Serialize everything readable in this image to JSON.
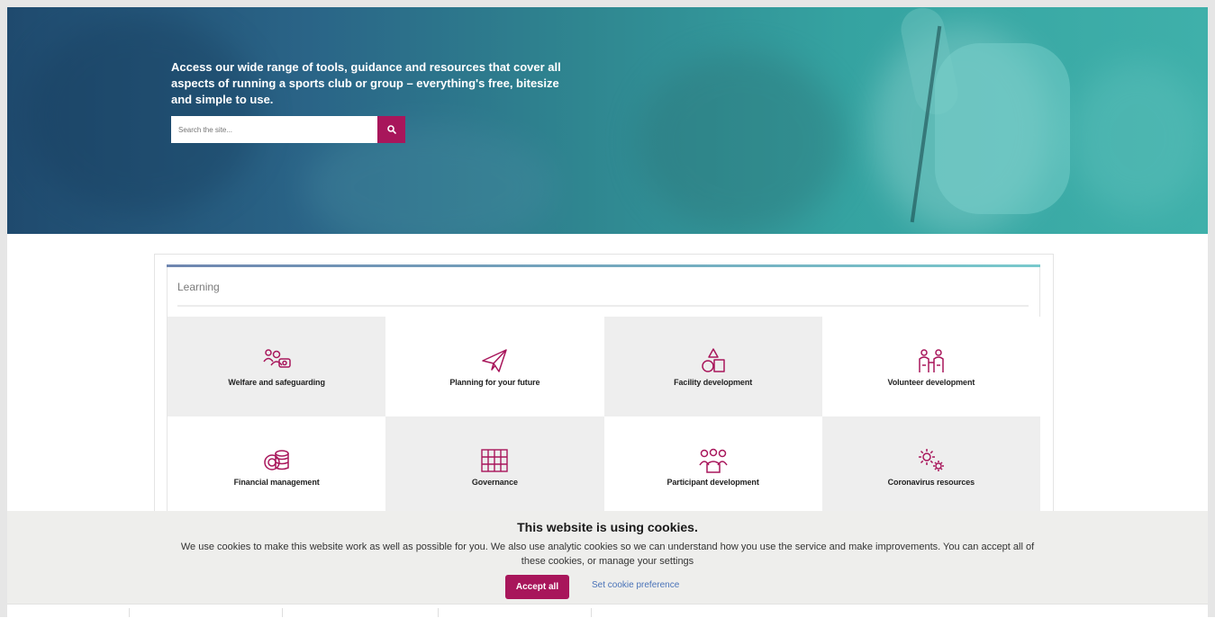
{
  "hero": {
    "text": "Access our wide range of tools, guidance and resources that cover all aspects of running a sports club or group – everything's free, bitesize and simple to use.",
    "search_placeholder": "Search the site...",
    "search_icon": "search-icon"
  },
  "learning": {
    "title": "Learning",
    "tiles": [
      {
        "label": "Welfare and safeguarding",
        "icon": "welfare-icon"
      },
      {
        "label": "Planning for your future",
        "icon": "paper-plane-icon"
      },
      {
        "label": "Facility development",
        "icon": "shapes-icon"
      },
      {
        "label": "Volunteer development",
        "icon": "volunteers-icon"
      },
      {
        "label": "Financial management",
        "icon": "coins-icon"
      },
      {
        "label": "Governance",
        "icon": "governance-icon"
      },
      {
        "label": "Participant development",
        "icon": "participants-icon"
      },
      {
        "label": "Coronavirus resources",
        "icon": "gears-icon"
      }
    ]
  },
  "cookie_banner": {
    "title": "This website is using cookies.",
    "body": "We use cookies to make this website work as well as possible for you. We also use analytic cookies so we can understand how you use the service and make improvements. You can accept all of these cookies, or manage your settings",
    "accept_label": "Accept all",
    "preference_label": "Set cookie preference"
  },
  "colors": {
    "accent": "#a8165b",
    "link": "#4a73b8",
    "hero_dark": "#1f4a6e",
    "hero_light": "#3fb0aa"
  }
}
